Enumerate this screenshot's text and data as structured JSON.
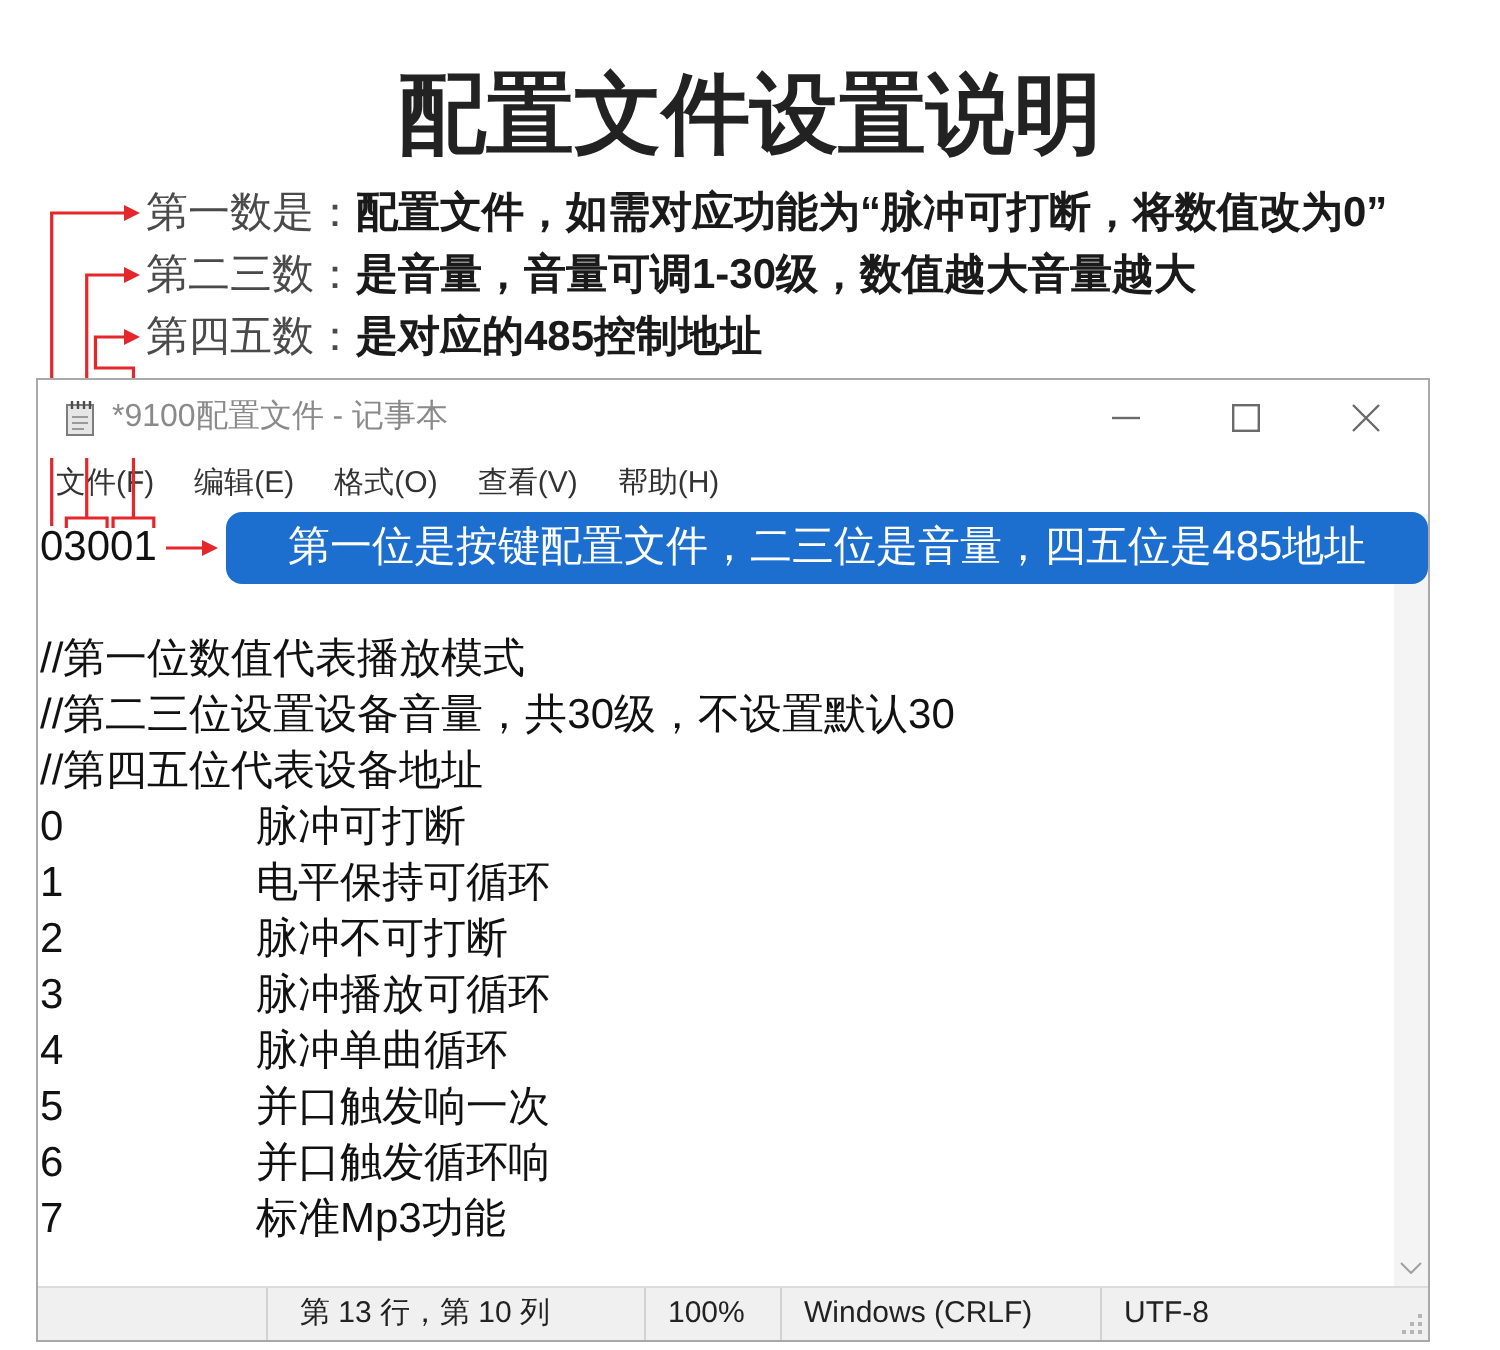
{
  "title": "配置文件设置说明",
  "notes": [
    "第一数是：**配置文件，如需对应功能为“脉冲可打断，将数值改为0”**",
    "第二三数：**是音量，音量可调1-30级，数值越大音量越大**",
    "第四五数：**是对应的485控制地址**"
  ],
  "window": {
    "title": "*9100配置文件 - 记事本",
    "menu": [
      "文件(F)",
      "编辑(E)",
      "格式(O)",
      "查看(V)",
      "帮助(H)"
    ],
    "document": {
      "first_line": "03001",
      "callout": "第一位是按键配置文件，二三位是音量，四五位是485地址",
      "lines": [
        "//第一位数值代表播放模式",
        "//第二三位设置设备音量，共30级，不设置默认30",
        "//第四五位代表设备地址",
        "0\t脉冲可打断",
        "1\t电平保持可循环",
        "2\t脉冲不可打断",
        "3\t脉冲播放可循环",
        "4\t脉冲单曲循环",
        "5\t并口触发响一次",
        "6\t并口触发循环响",
        "7\t标准Mp3功能"
      ]
    },
    "status_bar": [
      "第 13 行，第 10 列",
      "100%",
      "Windows (CRLF)",
      "UTF-8"
    ]
  }
}
